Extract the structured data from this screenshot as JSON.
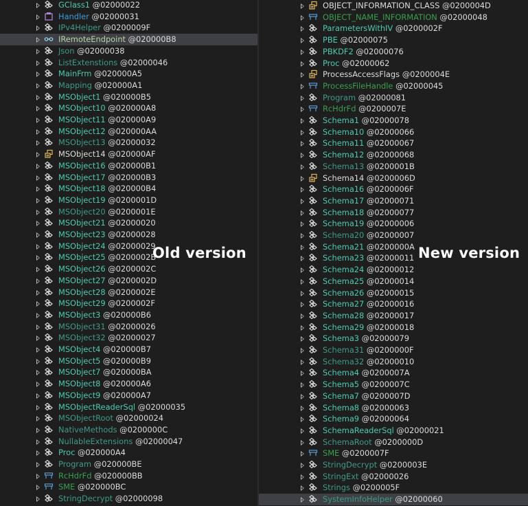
{
  "left_tree": [
    {
      "name": "GClass1",
      "token": "@02000022",
      "icon": "class-icon",
      "style": "norm"
    },
    {
      "name": "Handler",
      "token": "@02000031",
      "icon": "delegate-icon",
      "style": "blue"
    },
    {
      "name": "IPv4Helper",
      "token": "@0200009F",
      "icon": "class-icon",
      "style": "dim"
    },
    {
      "name": "IRemoteEndpoint",
      "token": "@020000B8",
      "icon": "interface-icon",
      "style": "iface",
      "selected": true
    },
    {
      "name": "Json",
      "token": "@02000038",
      "icon": "class-icon",
      "style": "dim"
    },
    {
      "name": "ListExtenstions",
      "token": "@02000046",
      "icon": "class-icon",
      "style": "dim"
    },
    {
      "name": "MainFrm",
      "token": "@020000A5",
      "icon": "class-icon",
      "style": "norm"
    },
    {
      "name": "Mapping",
      "token": "@020000A1",
      "icon": "class-icon",
      "style": "dim"
    },
    {
      "name": "MSObject1",
      "token": "@020000B5",
      "icon": "class-icon",
      "style": "norm"
    },
    {
      "name": "MSObject10",
      "token": "@020000A8",
      "icon": "class-icon",
      "style": "norm"
    },
    {
      "name": "MSObject11",
      "token": "@020000A9",
      "icon": "class-icon",
      "style": "norm"
    },
    {
      "name": "MSObject12",
      "token": "@020000AA",
      "icon": "class-icon",
      "style": "norm"
    },
    {
      "name": "MSObject13",
      "token": "@02000032",
      "icon": "class-icon",
      "style": "dim"
    },
    {
      "name": "MSObject14",
      "token": "@020000AF",
      "icon": "enum-icon",
      "style": "white"
    },
    {
      "name": "MSObject16",
      "token": "@020000B1",
      "icon": "class-icon",
      "style": "norm"
    },
    {
      "name": "MSObject17",
      "token": "@020000B3",
      "icon": "class-icon",
      "style": "norm"
    },
    {
      "name": "MSObject18",
      "token": "@020000B4",
      "icon": "class-icon",
      "style": "norm"
    },
    {
      "name": "MSObject19",
      "token": "@0200001D",
      "icon": "class-icon",
      "style": "norm"
    },
    {
      "name": "MSObject20",
      "token": "@0200001E",
      "icon": "class-icon",
      "style": "dim"
    },
    {
      "name": "MSObject21",
      "token": "@02000020",
      "icon": "class-icon",
      "style": "norm"
    },
    {
      "name": "MSObject23",
      "token": "@02000028",
      "icon": "class-icon",
      "style": "norm"
    },
    {
      "name": "MSObject24",
      "token": "@02000029",
      "icon": "class-icon",
      "style": "norm"
    },
    {
      "name": "MSObject25",
      "token": "@0200002B",
      "icon": "class-icon",
      "style": "norm"
    },
    {
      "name": "MSObject26",
      "token": "@0200002C",
      "icon": "class-icon",
      "style": "norm"
    },
    {
      "name": "MSObject27",
      "token": "@0200002D",
      "icon": "class-icon",
      "style": "norm"
    },
    {
      "name": "MSObject28",
      "token": "@0200002E",
      "icon": "class-icon",
      "style": "norm"
    },
    {
      "name": "MSObject29",
      "token": "@0200002F",
      "icon": "class-icon",
      "style": "norm"
    },
    {
      "name": "MSObject3",
      "token": "@020000B6",
      "icon": "class-icon",
      "style": "norm"
    },
    {
      "name": "MSObject31",
      "token": "@02000026",
      "icon": "class-icon",
      "style": "dim"
    },
    {
      "name": "MSObject32",
      "token": "@02000027",
      "icon": "class-icon",
      "style": "dim"
    },
    {
      "name": "MSObject4",
      "token": "@020000B7",
      "icon": "class-icon",
      "style": "norm"
    },
    {
      "name": "MSObject5",
      "token": "@020000B9",
      "icon": "class-icon",
      "style": "norm"
    },
    {
      "name": "MSObject7",
      "token": "@020000BA",
      "icon": "class-icon",
      "style": "norm"
    },
    {
      "name": "MSObject8",
      "token": "@020000A6",
      "icon": "class-icon",
      "style": "norm"
    },
    {
      "name": "MSObject9",
      "token": "@020000A7",
      "icon": "class-icon",
      "style": "norm"
    },
    {
      "name": "MSObjectReaderSql",
      "token": "@02000035",
      "icon": "class-icon",
      "style": "norm"
    },
    {
      "name": "MSObjectRoot",
      "token": "@02000024",
      "icon": "class-icon",
      "style": "dim"
    },
    {
      "name": "NativeMethods",
      "token": "@0200000C",
      "icon": "class-icon",
      "style": "dim"
    },
    {
      "name": "NullableExtensions",
      "token": "@02000047",
      "icon": "class-icon",
      "style": "dim"
    },
    {
      "name": "Proc",
      "token": "@020000A4",
      "icon": "class-icon",
      "style": "norm"
    },
    {
      "name": "Program",
      "token": "@020000BE",
      "icon": "class-icon",
      "style": "dim"
    },
    {
      "name": "RcHdrFd",
      "token": "@020000BB",
      "icon": "struct-icon",
      "style": "green"
    },
    {
      "name": "SME",
      "token": "@020000BC",
      "icon": "struct-icon",
      "style": "green"
    },
    {
      "name": "StringDecrypt",
      "token": "@02000098",
      "icon": "class-icon",
      "style": "dim"
    }
  ],
  "right_tree": [
    {
      "name": "OBJECT_INFORMATION_CLASS",
      "token": "@0200004D",
      "icon": "enum-icon",
      "style": "white"
    },
    {
      "name": "OBJECT_NAME_INFORMATION",
      "token": "@02000048",
      "icon": "struct-icon",
      "style": "green"
    },
    {
      "name": "ParametersWithIV",
      "token": "@0200002F",
      "icon": "class-icon",
      "style": "norm"
    },
    {
      "name": "PBE",
      "token": "@02000075",
      "icon": "class-icon",
      "style": "norm"
    },
    {
      "name": "PBKDF2",
      "token": "@02000076",
      "icon": "class-icon",
      "style": "norm"
    },
    {
      "name": "Proc",
      "token": "@02000062",
      "icon": "class-icon",
      "style": "norm"
    },
    {
      "name": "ProcessAccessFlags",
      "token": "@0200004E",
      "icon": "enum-icon",
      "style": "white"
    },
    {
      "name": "ProcessFileHandle",
      "token": "@02000045",
      "icon": "struct-icon",
      "style": "green"
    },
    {
      "name": "Program",
      "token": "@02000081",
      "icon": "class-icon",
      "style": "dim"
    },
    {
      "name": "RcHdrFd",
      "token": "@0200007E",
      "icon": "struct-icon",
      "style": "green"
    },
    {
      "name": "Schema1",
      "token": "@02000078",
      "icon": "class-icon",
      "style": "norm"
    },
    {
      "name": "Schema10",
      "token": "@02000066",
      "icon": "class-icon",
      "style": "norm"
    },
    {
      "name": "Schema11",
      "token": "@02000067",
      "icon": "class-icon",
      "style": "norm"
    },
    {
      "name": "Schema12",
      "token": "@02000068",
      "icon": "class-icon",
      "style": "norm"
    },
    {
      "name": "Schema13",
      "token": "@0200001B",
      "icon": "class-icon",
      "style": "dim"
    },
    {
      "name": "Schema14",
      "token": "@0200006D",
      "icon": "enum-icon",
      "style": "white"
    },
    {
      "name": "Schema16",
      "token": "@0200006F",
      "icon": "class-icon",
      "style": "norm"
    },
    {
      "name": "Schema17",
      "token": "@02000071",
      "icon": "class-icon",
      "style": "norm"
    },
    {
      "name": "Schema18",
      "token": "@02000077",
      "icon": "class-icon",
      "style": "norm"
    },
    {
      "name": "Schema19",
      "token": "@02000006",
      "icon": "class-icon",
      "style": "norm"
    },
    {
      "name": "Schema20",
      "token": "@02000007",
      "icon": "class-icon",
      "style": "dim"
    },
    {
      "name": "Schema21",
      "token": "@0200000A",
      "icon": "class-icon",
      "style": "norm"
    },
    {
      "name": "Schema23",
      "token": "@02000011",
      "icon": "class-icon",
      "style": "norm"
    },
    {
      "name": "Schema24",
      "token": "@02000012",
      "icon": "class-icon",
      "style": "norm"
    },
    {
      "name": "Schema25",
      "token": "@02000014",
      "icon": "class-icon",
      "style": "norm"
    },
    {
      "name": "Schema26",
      "token": "@02000015",
      "icon": "class-icon",
      "style": "norm"
    },
    {
      "name": "Schema27",
      "token": "@02000016",
      "icon": "class-icon",
      "style": "norm"
    },
    {
      "name": "Schema28",
      "token": "@02000017",
      "icon": "class-icon",
      "style": "norm"
    },
    {
      "name": "Schema29",
      "token": "@02000018",
      "icon": "class-icon",
      "style": "norm"
    },
    {
      "name": "Schema3",
      "token": "@02000079",
      "icon": "class-icon",
      "style": "norm"
    },
    {
      "name": "Schema31",
      "token": "@0200000F",
      "icon": "class-icon",
      "style": "dim"
    },
    {
      "name": "Schema32",
      "token": "@02000010",
      "icon": "class-icon",
      "style": "dim"
    },
    {
      "name": "Schema4",
      "token": "@0200007A",
      "icon": "class-icon",
      "style": "norm"
    },
    {
      "name": "Schema5",
      "token": "@0200007C",
      "icon": "class-icon",
      "style": "norm"
    },
    {
      "name": "Schema7",
      "token": "@0200007D",
      "icon": "class-icon",
      "style": "norm"
    },
    {
      "name": "Schema8",
      "token": "@02000063",
      "icon": "class-icon",
      "style": "norm"
    },
    {
      "name": "Schema9",
      "token": "@02000064",
      "icon": "class-icon",
      "style": "norm"
    },
    {
      "name": "SchemaReaderSql",
      "token": "@02000021",
      "icon": "class-icon",
      "style": "norm"
    },
    {
      "name": "SchemaRoot",
      "token": "@0200000D",
      "icon": "class-icon",
      "style": "dim"
    },
    {
      "name": "SME",
      "token": "@0200007F",
      "icon": "struct-icon",
      "style": "green"
    },
    {
      "name": "StringDecrypt",
      "token": "@0200003E",
      "icon": "class-icon",
      "style": "dim"
    },
    {
      "name": "StringExt",
      "token": "@02000026",
      "icon": "class-icon",
      "style": "dim"
    },
    {
      "name": "Strings",
      "token": "@0200005F",
      "icon": "class-icon",
      "style": "dim"
    },
    {
      "name": "SystemInfoHelper",
      "token": "@02000060",
      "icon": "class-icon",
      "style": "dim",
      "selected": true
    }
  ],
  "overlay": {
    "old_label": "Old version",
    "new_label": "New version"
  },
  "colors": {
    "background": "#1e1e1e",
    "class_name": "#4ec9b0",
    "selection": "#3f3f46",
    "overlay_text": "#ffffff"
  }
}
